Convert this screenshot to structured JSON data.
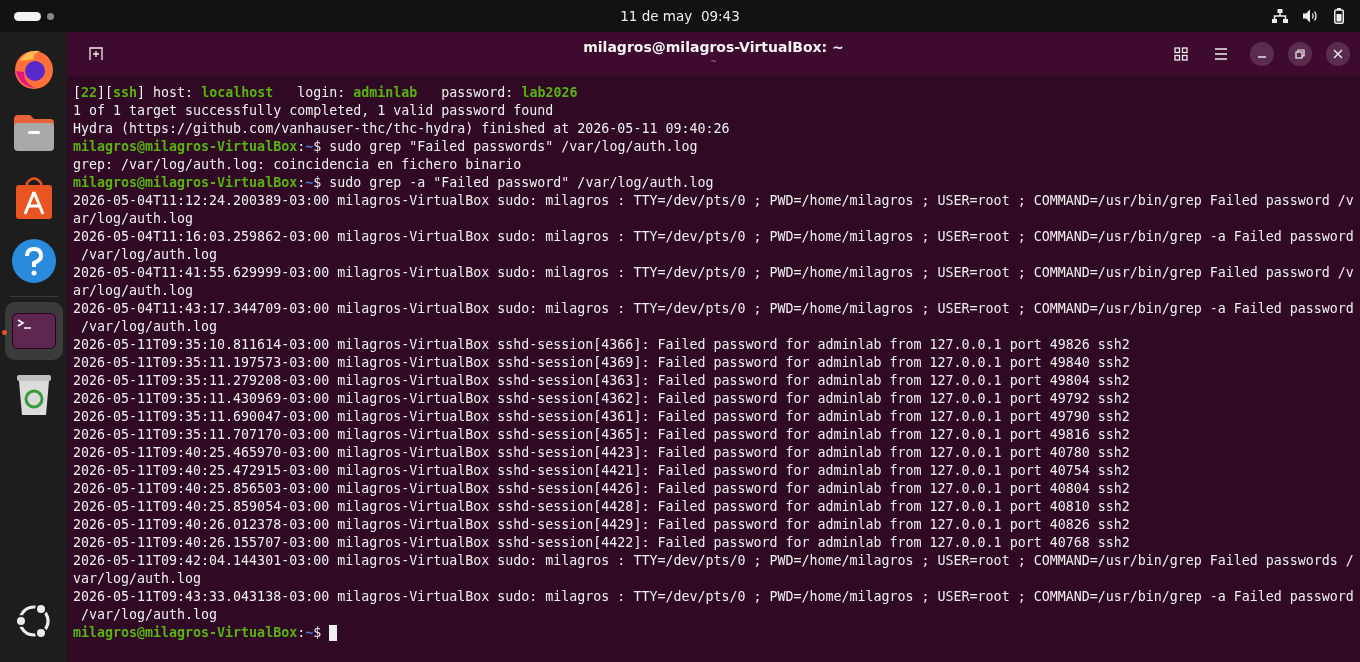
{
  "top_bar": {
    "date": "11 de may",
    "time": "09:43"
  },
  "dock": {
    "items": [
      {
        "kind": "firefox",
        "running": false,
        "selected": false
      },
      {
        "kind": "files",
        "running": false,
        "selected": false
      },
      {
        "kind": "store",
        "running": false,
        "selected": false
      },
      {
        "kind": "help",
        "running": false,
        "selected": false
      },
      {
        "kind": "terminal",
        "running": true,
        "selected": true
      },
      {
        "kind": "trash",
        "running": false,
        "selected": false
      }
    ]
  },
  "window": {
    "title": "milagros@milagros-VirtualBox: ~",
    "subtitle": "~"
  },
  "terminal": {
    "lines": [
      {
        "kind": "segments",
        "parts": [
          {
            "text": "[",
            "highlight": false
          },
          {
            "text": "22",
            "highlight": true
          },
          {
            "text": "][",
            "highlight": false
          },
          {
            "text": "ssh",
            "highlight": true
          },
          {
            "text": "] host: ",
            "highlight": false
          },
          {
            "text": "localhost",
            "highlight": true
          },
          {
            "text": "   login: ",
            "highlight": false
          },
          {
            "text": "adminlab",
            "highlight": true
          },
          {
            "text": "   password: ",
            "highlight": false
          },
          {
            "text": "lab2026",
            "highlight": true
          }
        ]
      },
      {
        "kind": "output",
        "text": "1 of 1 target successfully completed, 1 valid password found"
      },
      {
        "kind": "output",
        "text": "Hydra (https://github.com/vanhauser-thc/thc-hydra) finished at 2026-05-11 09:40:26"
      },
      {
        "kind": "prompt",
        "user_host": "milagros@milagros-VirtualBox",
        "separator": ":",
        "path": "~",
        "symbol": "$",
        "command": "sudo grep \"Failed passwords\" /var/log/auth.log",
        "cursor": false
      },
      {
        "kind": "output",
        "text": "grep: /var/log/auth.log: coincidencia en fichero binario"
      },
      {
        "kind": "prompt",
        "user_host": "milagros@milagros-VirtualBox",
        "separator": ":",
        "path": "~",
        "symbol": "$",
        "command": "sudo grep -a \"Failed password\" /var/log/auth.log",
        "cursor": false
      },
      {
        "kind": "output",
        "text": "2026-05-04T11:12:24.200389-03:00 milagros-VirtualBox sudo: milagros : TTY=/dev/pts/0 ; PWD=/home/milagros ; USER=root ; COMMAND=/usr/bin/grep Failed password /v"
      },
      {
        "kind": "output",
        "text": "ar/log/auth.log"
      },
      {
        "kind": "output",
        "text": "2026-05-04T11:16:03.259862-03:00 milagros-VirtualBox sudo: milagros : TTY=/dev/pts/0 ; PWD=/home/milagros ; USER=root ; COMMAND=/usr/bin/grep -a Failed password"
      },
      {
        "kind": "output",
        "text": " /var/log/auth.log"
      },
      {
        "kind": "output",
        "text": "2026-05-04T11:41:55.629999-03:00 milagros-VirtualBox sudo: milagros : TTY=/dev/pts/0 ; PWD=/home/milagros ; USER=root ; COMMAND=/usr/bin/grep Failed password /v"
      },
      {
        "kind": "output",
        "text": "ar/log/auth.log"
      },
      {
        "kind": "output",
        "text": "2026-05-04T11:43:17.344709-03:00 milagros-VirtualBox sudo: milagros : TTY=/dev/pts/0 ; PWD=/home/milagros ; USER=root ; COMMAND=/usr/bin/grep -a Failed password"
      },
      {
        "kind": "output",
        "text": " /var/log/auth.log"
      },
      {
        "kind": "output",
        "text": "2026-05-11T09:35:10.811614-03:00 milagros-VirtualBox sshd-session[4366]: Failed password for adminlab from 127.0.0.1 port 49826 ssh2"
      },
      {
        "kind": "output",
        "text": "2026-05-11T09:35:11.197573-03:00 milagros-VirtualBox sshd-session[4369]: Failed password for adminlab from 127.0.0.1 port 49840 ssh2"
      },
      {
        "kind": "output",
        "text": "2026-05-11T09:35:11.279208-03:00 milagros-VirtualBox sshd-session[4363]: Failed password for adminlab from 127.0.0.1 port 49804 ssh2"
      },
      {
        "kind": "output",
        "text": "2026-05-11T09:35:11.430969-03:00 milagros-VirtualBox sshd-session[4362]: Failed password for adminlab from 127.0.0.1 port 49792 ssh2"
      },
      {
        "kind": "output",
        "text": "2026-05-11T09:35:11.690047-03:00 milagros-VirtualBox sshd-session[4361]: Failed password for adminlab from 127.0.0.1 port 49790 ssh2"
      },
      {
        "kind": "output",
        "text": "2026-05-11T09:35:11.707170-03:00 milagros-VirtualBox sshd-session[4365]: Failed password for adminlab from 127.0.0.1 port 49816 ssh2"
      },
      {
        "kind": "output",
        "text": "2026-05-11T09:40:25.465970-03:00 milagros-VirtualBox sshd-session[4423]: Failed password for adminlab from 127.0.0.1 port 40780 ssh2"
      },
      {
        "kind": "output",
        "text": "2026-05-11T09:40:25.472915-03:00 milagros-VirtualBox sshd-session[4421]: Failed password for adminlab from 127.0.0.1 port 40754 ssh2"
      },
      {
        "kind": "output",
        "text": "2026-05-11T09:40:25.856503-03:00 milagros-VirtualBox sshd-session[4426]: Failed password for adminlab from 127.0.0.1 port 40804 ssh2"
      },
      {
        "kind": "output",
        "text": "2026-05-11T09:40:25.859054-03:00 milagros-VirtualBox sshd-session[4428]: Failed password for adminlab from 127.0.0.1 port 40810 ssh2"
      },
      {
        "kind": "output",
        "text": "2026-05-11T09:40:26.012378-03:00 milagros-VirtualBox sshd-session[4429]: Failed password for adminlab from 127.0.0.1 port 40826 ssh2"
      },
      {
        "kind": "output",
        "text": "2026-05-11T09:40:26.155707-03:00 milagros-VirtualBox sshd-session[4422]: Failed password for adminlab from 127.0.0.1 port 40768 ssh2"
      },
      {
        "kind": "output",
        "text": "2026-05-11T09:42:04.144301-03:00 milagros-VirtualBox sudo: milagros : TTY=/dev/pts/0 ; PWD=/home/milagros ; USER=root ; COMMAND=/usr/bin/grep Failed passwords /"
      },
      {
        "kind": "output",
        "text": "var/log/auth.log"
      },
      {
        "kind": "output",
        "text": "2026-05-11T09:43:33.043138-03:00 milagros-VirtualBox sudo: milagros : TTY=/dev/pts/0 ; PWD=/home/milagros ; USER=root ; COMMAND=/usr/bin/grep -a Failed password"
      },
      {
        "kind": "output",
        "text": " /var/log/auth.log"
      },
      {
        "kind": "prompt",
        "user_host": "milagros@milagros-VirtualBox",
        "separator": ":",
        "path": "~",
        "symbol": "$",
        "cursor": true
      }
    ]
  }
}
